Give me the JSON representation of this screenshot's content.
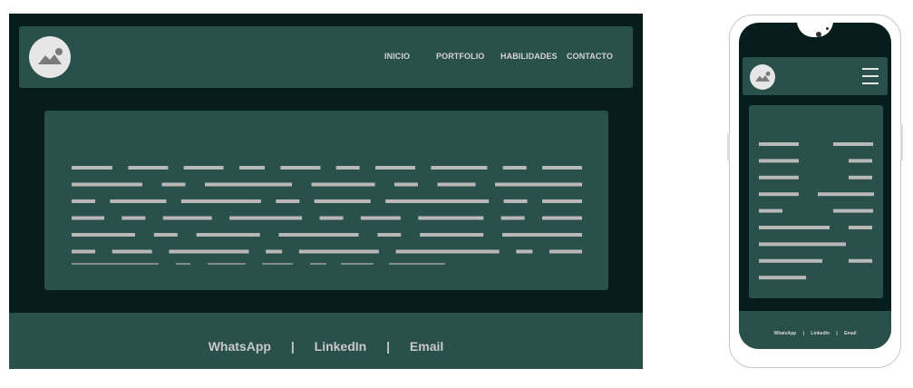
{
  "colors": {
    "page_bg": "#061d1c",
    "surface": "#2a504c",
    "text_muted": "#d4d4d4",
    "placeholder_line": "#b8b8b8",
    "logo_bg": "#e6e6e6"
  },
  "desktop": {
    "logo_icon": "image-placeholder-icon",
    "nav": {
      "items": [
        "INICIO",
        "PORTFOLIO",
        "HABILIDADES",
        "CONTACTO"
      ]
    },
    "footer": {
      "links": [
        "WhatsApp",
        "LinkedIn",
        "Email"
      ],
      "separator": "|"
    }
  },
  "mobile": {
    "logo_icon": "image-placeholder-icon",
    "menu_icon": "hamburger-menu-icon",
    "footer": {
      "links": [
        "WhatsApp",
        "LinkedIn",
        "Email"
      ],
      "separator": "|"
    }
  }
}
